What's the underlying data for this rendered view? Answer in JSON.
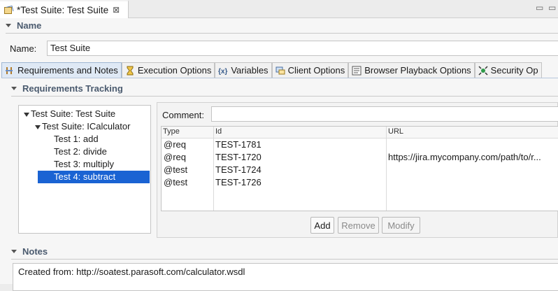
{
  "editor": {
    "title": "*Test Suite: Test Suite",
    "close_glyph": "⊠"
  },
  "window_controls": {
    "minimize": "▭",
    "maximize": "▭"
  },
  "name_section": {
    "heading": "Name",
    "field_label": "Name:",
    "field_value": "Test Suite"
  },
  "tabs": [
    {
      "label": "Requirements and Notes",
      "icon": "requirements-icon",
      "active": true
    },
    {
      "label": "Execution Options",
      "icon": "hourglass-icon",
      "active": false
    },
    {
      "label": "Variables",
      "icon": "variables-icon",
      "active": false
    },
    {
      "label": "Client Options",
      "icon": "client-icon",
      "active": false
    },
    {
      "label": "Browser Playback Options",
      "icon": "browser-icon",
      "active": false
    },
    {
      "label": "Security Op",
      "icon": "security-icon",
      "active": false
    }
  ],
  "requirements": {
    "heading": "Requirements Tracking",
    "tree": [
      {
        "label": "Test Suite: Test Suite",
        "level": 0,
        "expanded": true
      },
      {
        "label": "Test Suite: ICalculator",
        "level": 1,
        "expanded": true
      },
      {
        "label": "Test 1: add",
        "level": 2
      },
      {
        "label": "Test 2: divide",
        "level": 2
      },
      {
        "label": "Test 3: multiply",
        "level": 2
      },
      {
        "label": "Test 4: subtract",
        "level": 2,
        "selected": true
      }
    ],
    "comment_label": "Comment:",
    "comment_value": "",
    "table": {
      "headers": [
        "Type",
        "Id",
        "URL"
      ],
      "rows": [
        {
          "type": "@req",
          "id": "TEST-1781",
          "url": ""
        },
        {
          "type": "@req",
          "id": "TEST-1720",
          "url": "https://jira.mycompany.com/path/to/r..."
        },
        {
          "type": "@test",
          "id": "TEST-1724",
          "url": ""
        },
        {
          "type": "@test",
          "id": "TEST-1726",
          "url": ""
        }
      ]
    },
    "buttons": {
      "add": "Add",
      "remove": "Remove",
      "modify": "Modify"
    }
  },
  "notes": {
    "heading": "Notes",
    "text": "Created from: http://soatest.parasoft.com/calculator.wsdl"
  },
  "colors": {
    "selection": "#1a63d3",
    "section_heading": "#4a5a6e",
    "active_tab": "#dfe9f5"
  }
}
